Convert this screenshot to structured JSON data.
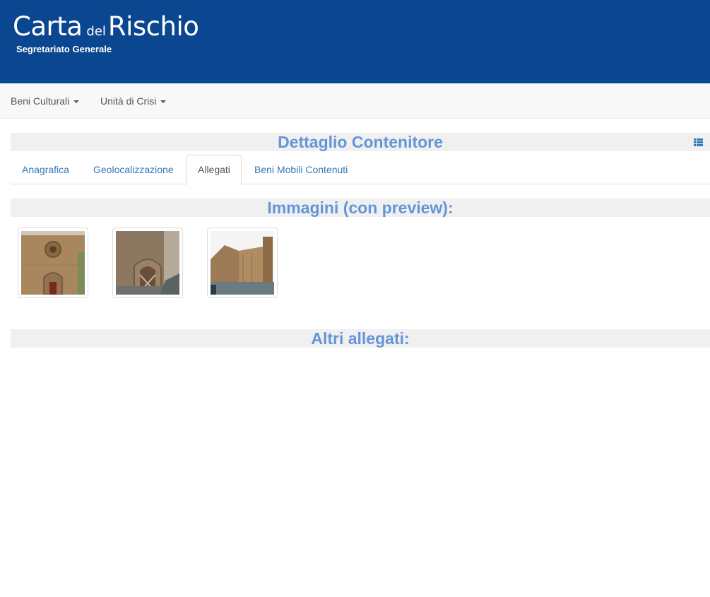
{
  "header": {
    "brand_carta": "Carta",
    "brand_del": "del",
    "brand_rischio": "Rischio",
    "subtitle": "Segretariato Generale"
  },
  "navbar": {
    "items": [
      {
        "label": "Beni Culturali"
      },
      {
        "label": "Unità di Crisi"
      }
    ]
  },
  "main": {
    "title": "Dettaglio Contenitore",
    "tabs": [
      {
        "label": "Anagrafica"
      },
      {
        "label": "Geolocalizzazione"
      },
      {
        "label": "Allegati"
      },
      {
        "label": "Beni Mobili Contenuti"
      }
    ],
    "active_tab": "Allegati",
    "images_section_title": "Immagini (con preview):",
    "other_attachments_title": "Altri allegati:"
  },
  "colors": {
    "banner": "#0b4690",
    "section_heading": "#6495d8",
    "link": "#337ab7"
  }
}
